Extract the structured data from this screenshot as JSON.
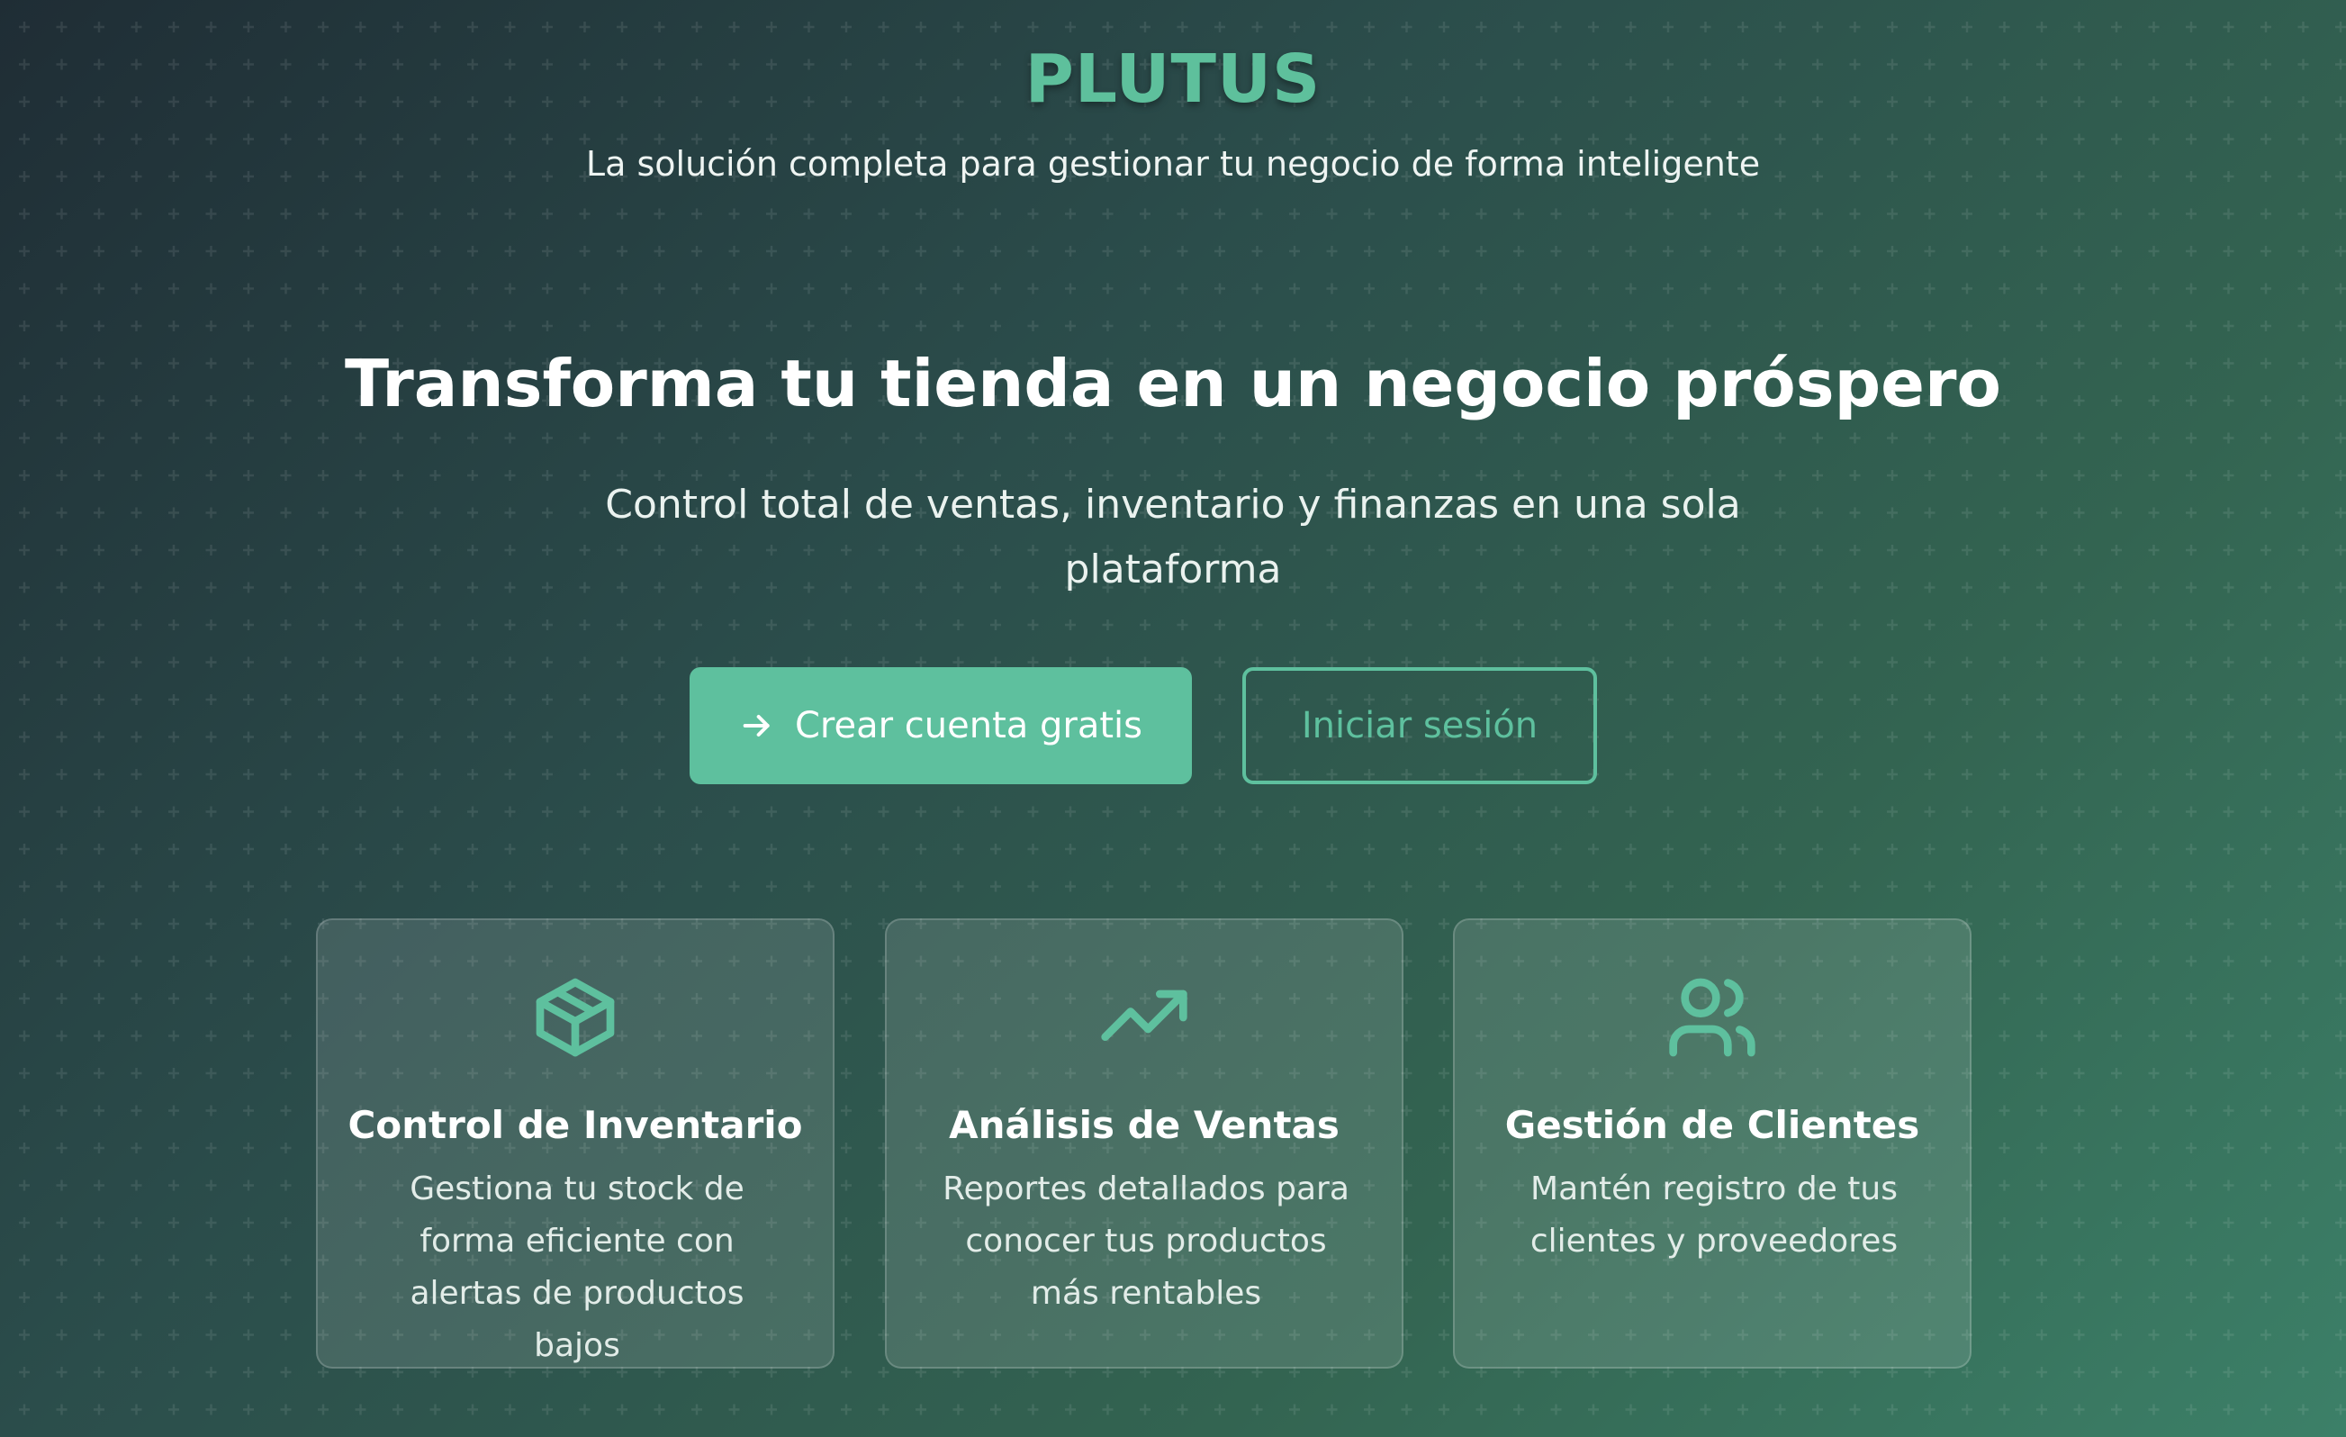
{
  "brand": {
    "name": "PLUTUS",
    "tagline": "La solución completa para gestionar tu negocio de forma inteligente"
  },
  "hero": {
    "title": "Transforma tu tienda en un negocio próspero",
    "subtitle": "Control total de ventas, inventario y finanzas en una sola plataforma"
  },
  "actions": {
    "primary_label": "Crear cuenta gratis",
    "primary_icon": "arrow-right-icon",
    "secondary_label": "Iniciar sesión"
  },
  "features": [
    {
      "icon": "box-icon",
      "title": "Control de Inventario",
      "description": "Gestiona tu stock de forma eficiente con alertas de productos bajos"
    },
    {
      "icon": "trending-up-icon",
      "title": "Análisis de Ventas",
      "description": "Reportes detallados para conocer tus productos más rentables"
    },
    {
      "icon": "users-icon",
      "title": "Gestión de Clientes",
      "description": "Mantén registro de tus clientes y proveedores"
    }
  ],
  "colors": {
    "accent": "#5ec09e",
    "background_start": "#1f2d35",
    "background_end": "#3c8068"
  }
}
